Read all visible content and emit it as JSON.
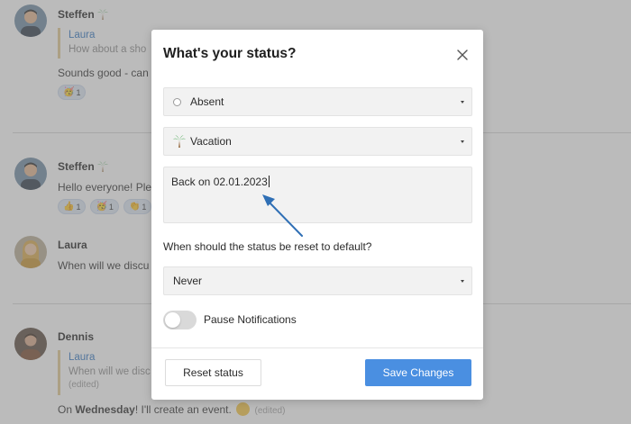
{
  "chat": {
    "messages": [
      {
        "author": "Steffen",
        "quote_author": "Laura",
        "quote_text": "How about a sho",
        "text": "Sounds good - can y",
        "reactions": [
          {
            "emoji": "celebrate",
            "count": "1"
          }
        ]
      },
      {
        "author": "Steffen",
        "text": "Hello everyone! Ple",
        "reactions": [
          {
            "emoji": "thumbs-up",
            "count": "1"
          },
          {
            "emoji": "celebrate",
            "count": "1"
          },
          {
            "emoji": "clap",
            "count": "1"
          }
        ]
      },
      {
        "author": "Laura",
        "text": "When will we discu"
      },
      {
        "author": "Dennis",
        "quote_author": "Laura",
        "quote_text": "When will we disc",
        "quote_edited": "(edited)",
        "text_before": "On ",
        "text_bold": "Wednesday",
        "text_after": "! I'll create an event.",
        "edited": "(edited)"
      }
    ]
  },
  "modal": {
    "title": "What's your status?",
    "presence_select": {
      "value": "Absent",
      "icon": "radio-circle-icon"
    },
    "status_select": {
      "value": "Vacation",
      "icon": "palm-tree-icon"
    },
    "status_message": {
      "value": "Back on 02.01.2023"
    },
    "reset_question": "When should the status be reset to default?",
    "reset_select": {
      "value": "Never"
    },
    "pause_notifications": {
      "label": "Pause Notifications",
      "enabled": false
    },
    "buttons": {
      "reset": "Reset status",
      "save": "Save Changes"
    }
  },
  "colors": {
    "save_button": "#4a8fe1",
    "arrow": "#2f6fb5",
    "quote_author": "#2f74c0",
    "overlay": "#787878"
  }
}
